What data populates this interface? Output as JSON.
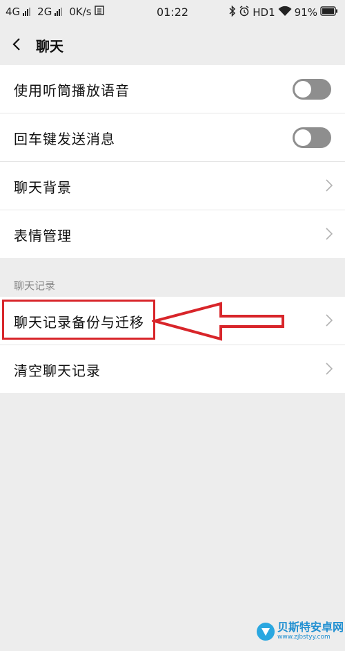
{
  "status_bar": {
    "sim1": "4G",
    "sim2": "2G",
    "speed": "0K/s",
    "time": "01:22",
    "hd": "HD1",
    "battery": "91%"
  },
  "nav": {
    "title": "聊天"
  },
  "group1": [
    {
      "label": "使用听筒播放语音",
      "control": "toggle",
      "on": false
    },
    {
      "label": "回车键发送消息",
      "control": "toggle",
      "on": false
    },
    {
      "label": "聊天背景",
      "control": "chevron"
    },
    {
      "label": "表情管理",
      "control": "chevron"
    }
  ],
  "section": {
    "title": "聊天记录"
  },
  "group2": [
    {
      "label": "聊天记录备份与迁移",
      "control": "chevron"
    },
    {
      "label": "清空聊天记录",
      "control": "chevron"
    }
  ],
  "watermark": {
    "name": "贝斯特安卓网",
    "url": "www.zjbstyy.com"
  },
  "colors": {
    "background": "#ededed",
    "row": "#ffffff",
    "toggle_off": "#8e8e8e",
    "annotation_red": "#d8252a"
  }
}
